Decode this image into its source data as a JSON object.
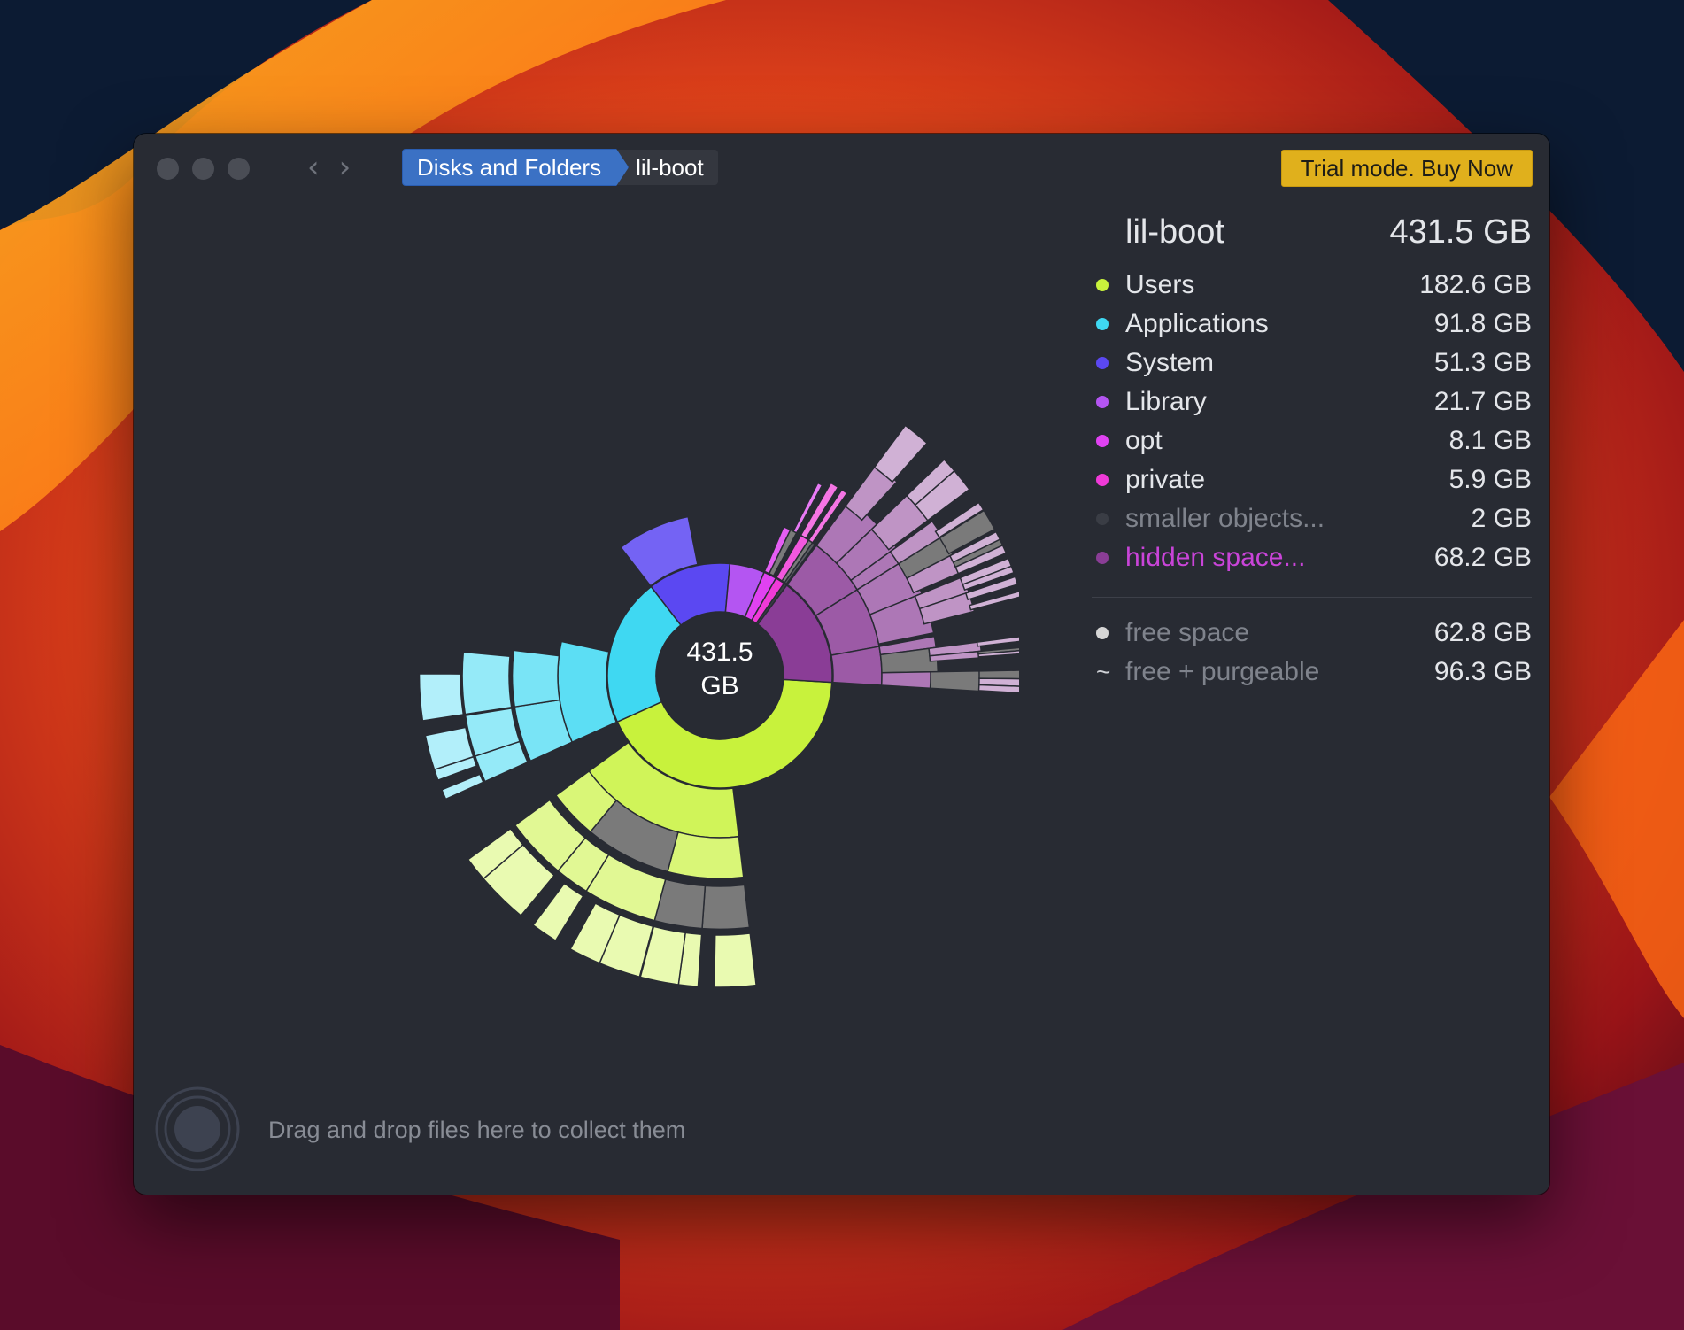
{
  "toolbar": {
    "back_icon": "chevron-left-icon",
    "forward_icon": "chevron-right-icon",
    "breadcrumb_root": "Disks and Folders",
    "breadcrumb_current": "lil-boot",
    "buy_label": "Trial mode. Buy Now"
  },
  "chart_center": {
    "value": "431.5",
    "unit": "GB"
  },
  "panel": {
    "title": "lil-boot",
    "total": "431.5 GB",
    "items": [
      {
        "name": "Users",
        "size": "182.6 GB",
        "color": "#c8f23c"
      },
      {
        "name": "Applications",
        "size": "91.8 GB",
        "color": "#3fd8f2"
      },
      {
        "name": "System",
        "size": "51.3 GB",
        "color": "#5b48f2"
      },
      {
        "name": "Library",
        "size": "21.7 GB",
        "color": "#b455f2"
      },
      {
        "name": "opt",
        "size": "8.1 GB",
        "color": "#e042f2"
      },
      {
        "name": "private",
        "size": "5.9 GB",
        "color": "#f03ad8"
      },
      {
        "name": "smaller objects...",
        "size": "2    GB",
        "color": "#3a3d45"
      },
      {
        "name": "hidden space...",
        "size": "68.2 GB",
        "color": "#8a3d96"
      }
    ],
    "free": [
      {
        "marker": "dot",
        "name": "free space",
        "size": "62.8 GB",
        "color": "#d6d6d6"
      },
      {
        "marker": "~",
        "name": "free + purgeable",
        "size": "96.3 GB"
      }
    ]
  },
  "dropzone": {
    "text": "Drag and drop files here to collect them"
  },
  "chart_data": {
    "type": "sunburst",
    "title": "",
    "root": "lil-boot",
    "total_gb": 431.5,
    "segments": [
      {
        "name": "Users",
        "value": 182.6
      },
      {
        "name": "Applications",
        "value": 91.8
      },
      {
        "name": "System",
        "value": 51.3
      },
      {
        "name": "Library",
        "value": 21.7
      },
      {
        "name": "opt",
        "value": 8.1
      },
      {
        "name": "private",
        "value": 5.9
      },
      {
        "name": "smaller objects...",
        "value": 2
      },
      {
        "name": "hidden space...",
        "value": 68.2
      }
    ]
  }
}
